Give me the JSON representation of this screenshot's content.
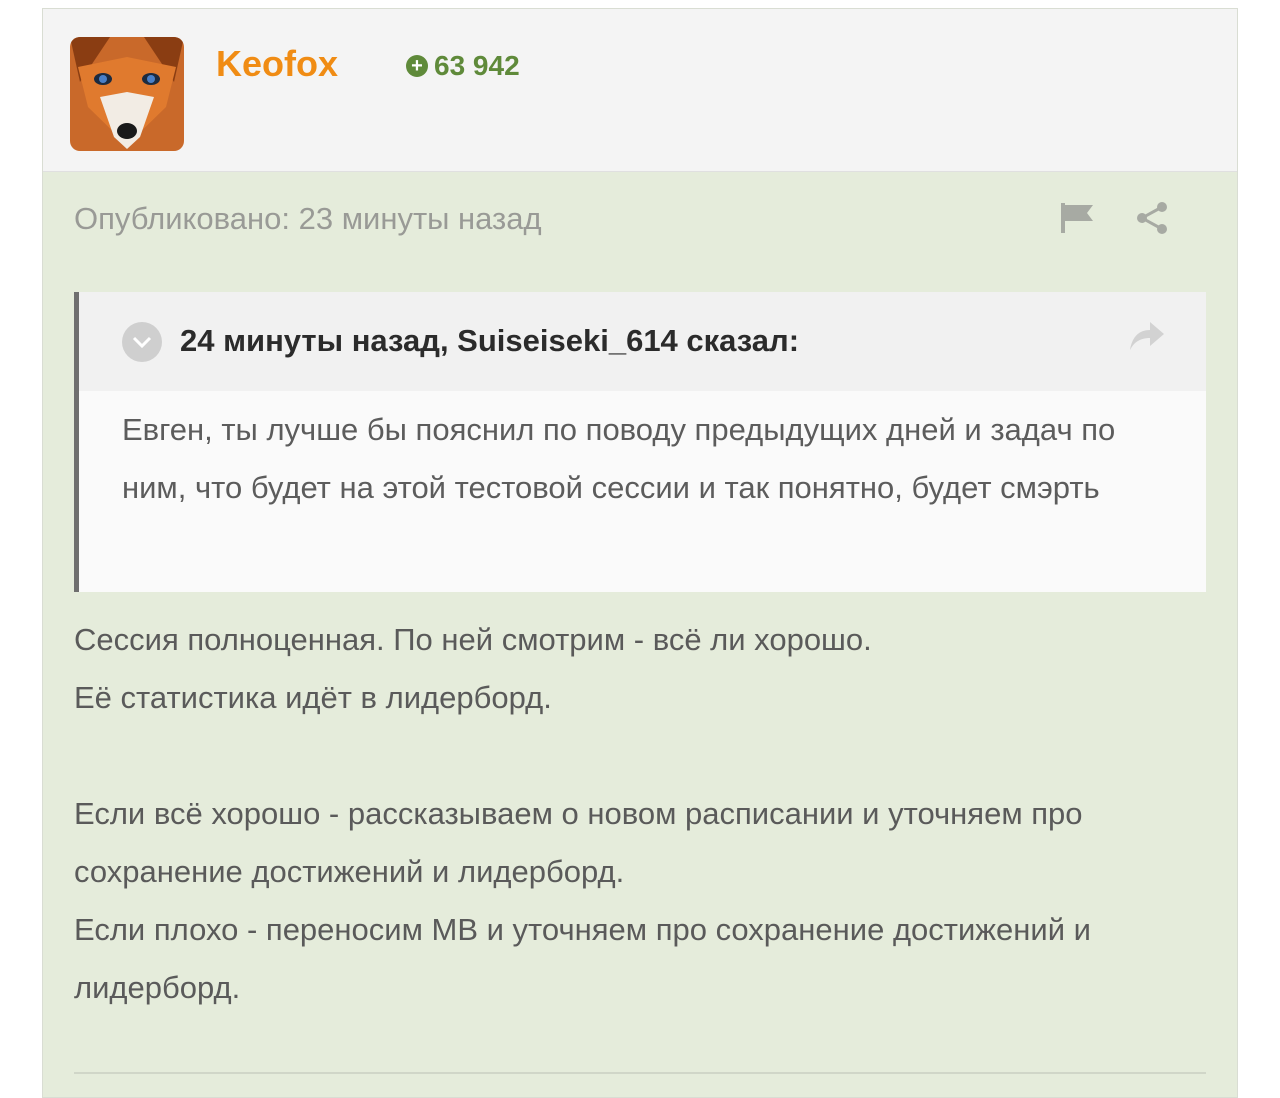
{
  "post": {
    "author": {
      "username": "Keofox",
      "avatar": "fox-avatar",
      "reputation": "63 942",
      "reputation_icon": "plus-circle-icon"
    },
    "meta": {
      "published": "Опубликовано: 23 минуты назад",
      "icons": [
        "flag-icon",
        "share-icon"
      ]
    },
    "quote": {
      "title": "24 минуты назад, Suiseiseki_614 сказал:",
      "text": "Евген, ты лучше бы пояснил по поводу предыдущих дней и задач по ним, что будет на этой тестовой сессии и так понятно, будет смэрть"
    },
    "body": {
      "line1": "Сессия полноценная. По ней смотрим - всё ли хорошо.",
      "line2": "Её статистика идёт в лидерборд.",
      "line3": "Если всё хорошо - рассказываем о новом расписании и уточняем про сохранение достижений и лидерборд.",
      "line4": "Если плохо - переносим МВ и уточняем про сохранение достижений и лидерборд."
    }
  },
  "colors": {
    "username": "#f08c14",
    "reputation": "#5f8a3a",
    "card_bg": "#e5ecdb"
  }
}
